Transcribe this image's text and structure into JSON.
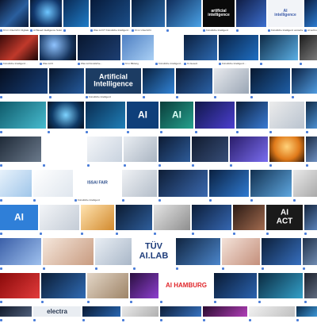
{
  "rows": [
    {
      "tiles": [
        {
          "bg": "linear-gradient(135deg,#0b1630,#2a5f9e 55,#0a1a3a)",
          "caption": "KI im Unterricht: Digitale..."
        },
        {
          "bg": "radial-gradient(circle at 55% 45%,#6ec6ff,#12386d 60%,#051224)",
          "caption": "AI Based Intelligence Solutions..."
        },
        {
          "bg": "linear-gradient(135deg,#0a2a55,#1f7dc9)",
          "caption": ""
        },
        {
          "bg": "linear-gradient(135deg,#071a3a,#1b4f8a)",
          "caption": "Was ist KI? Künstliche Intelligenz..."
        },
        {
          "bg": "linear-gradient(135deg,#09203f,#2c6db0)",
          "caption": "KI im Unterricht"
        },
        {
          "bg": "linear-gradient(135deg,#0f2c5a,#4aa3e8)",
          "caption": ""
        },
        {
          "bg": "#0a0a0a",
          "caption": "Künstliche Intelligenz",
          "text": "artificial\nintelligence",
          "color": "#ffffff"
        },
        {
          "bg": "linear-gradient(135deg,#101d45,#3c6fd0)",
          "caption": ""
        },
        {
          "bg": "#f2f4f8",
          "caption": "Künstliche Intelligenz verstehen",
          "text": "AI\nintelligence",
          "color": "#3b5aa8"
        },
        {
          "bg": "linear-gradient(135deg,#0a1d40,#2b7bd1)",
          "caption": "AI technology..."
        },
        {
          "bg": "linear-gradient(135deg,#1a0b3a,#7b2fbf 60,#0d0a24)",
          "caption": ""
        }
      ]
    },
    {
      "tiles": [
        {
          "bg": "linear-gradient(135deg,#3a0a0a,#c0392b 55,#1a0505)",
          "caption": "Künstliche Intelligenz..."
        },
        {
          "bg": "radial-gradient(circle at 40% 40%,#8fc3ff,#17355e 65%,#050d1c)",
          "caption": "Was ist KI"
        },
        {
          "bg": "linear-gradient(135deg,#08162e,#1d3f73)",
          "caption": "Was ist Künstliche..."
        },
        {
          "bg": "linear-gradient(135deg,#4e7fc2,#aad0f5)",
          "caption": "KI in Bildung"
        },
        {
          "bg": "#ffffff",
          "caption": "Künstliche Intelligenz..."
        },
        {
          "bg": "linear-gradient(135deg,#0b1f3d,#2d6ab3)",
          "caption": "KI-Gesetz"
        },
        {
          "bg": "linear-gradient(135deg,#0a2244,#1f6fc4)",
          "caption": "Künstliche Intelligenz..."
        },
        {
          "bg": "linear-gradient(135deg,#0e2a45,#5bb0e6)",
          "caption": ""
        },
        {
          "bg": "linear-gradient(135deg,#1b1b1b,#7a7a7a)",
          "caption": ""
        }
      ]
    },
    {
      "tiles": [
        {
          "bg": "linear-gradient(135deg,#050d1e,#17407a)",
          "caption": ""
        },
        {
          "bg": "linear-gradient(135deg,#07152b,#245a9d)",
          "caption": ""
        },
        {
          "bg": "#1c3c63",
          "caption": "Künstliche Intelligenz",
          "text": "Artificial\nIntelligence",
          "color": "#ffffff"
        },
        {
          "bg": "linear-gradient(135deg,#09203d,#3183d6)",
          "caption": ""
        },
        {
          "bg": "linear-gradient(135deg,#0c1a33,#2a62a8)",
          "caption": ""
        },
        {
          "bg": "linear-gradient(135deg,#e8eaee,#9aa6b5)",
          "caption": ""
        },
        {
          "bg": "linear-gradient(135deg,#08182f,#1e5ea6)",
          "caption": ""
        },
        {
          "bg": "linear-gradient(135deg,#0b2040,#4f9be0)",
          "caption": ""
        }
      ]
    },
    {
      "tiles": [
        {
          "bg": "linear-gradient(135deg,#0f5a6a,#47bcd0)",
          "caption": ""
        },
        {
          "bg": "radial-gradient(circle at 50% 50%,#7dd3ff,#0f3a66 60%,#04101f)",
          "caption": ""
        },
        {
          "bg": "linear-gradient(135deg,#0a2b4f,#1f7fb8)",
          "caption": ""
        },
        {
          "bg": "#0f3f7a",
          "caption": "",
          "text": "AI",
          "color": "#ffffff"
        },
        {
          "bg": "linear-gradient(135deg,#0a3d3a,#25a18e)",
          "caption": "",
          "text": "AI",
          "color": "#d9fff5"
        },
        {
          "bg": "linear-gradient(135deg,#10174a,#4b3fd0)",
          "caption": ""
        },
        {
          "bg": "linear-gradient(135deg,#0b1f3a,#3a7bd5)",
          "caption": ""
        },
        {
          "bg": "linear-gradient(135deg,#ececec,#b9c3cf)",
          "caption": ""
        },
        {
          "bg": "linear-gradient(135deg,#102a45,#4c8fd1)",
          "caption": ""
        }
      ]
    },
    {
      "tiles": [
        {
          "bg": "linear-gradient(135deg,#1f2a38,#6b7a8c)",
          "caption": ""
        },
        {
          "bg": "#ffffff",
          "caption": ""
        },
        {
          "bg": "linear-gradient(135deg,#f4f6f9,#c9d3df)",
          "caption": ""
        },
        {
          "bg": "linear-gradient(135deg,#e9edf2,#aab5c2)",
          "caption": ""
        },
        {
          "bg": "linear-gradient(135deg,#0d1b33,#2d5b99)",
          "caption": ""
        },
        {
          "bg": "linear-gradient(135deg,#111b2e,#374e79)",
          "caption": ""
        },
        {
          "bg": "linear-gradient(135deg,#2a1d6a,#7a6df0)",
          "caption": ""
        },
        {
          "bg": "radial-gradient(circle at 50% 40%,#ffd27a,#e07a1a 55%,#2a1406)",
          "caption": ""
        },
        {
          "bg": "linear-gradient(135deg,#1b2b44,#6d8fc0)",
          "caption": ""
        }
      ]
    },
    {
      "tiles": [
        {
          "bg": "linear-gradient(135deg,#e8f2fb,#9fc6ea)",
          "caption": ""
        },
        {
          "bg": "linear-gradient(135deg,#ffffff,#dfe6ee)",
          "caption": ""
        },
        {
          "bg": "#ffffff",
          "caption": "Künstliche Intelligenz",
          "text": "ISSAI FAIR",
          "color": "#2a4c8a"
        },
        {
          "bg": "linear-gradient(135deg,#f0f2f5,#b3bdc9)",
          "caption": ""
        },
        {
          "bg": "linear-gradient(135deg,#0e1d35,#3a69b0)",
          "caption": ""
        },
        {
          "bg": "linear-gradient(135deg,#0a2040,#2f7ad1)",
          "caption": ""
        },
        {
          "bg": "linear-gradient(135deg,#12304f,#5ea7e0)",
          "caption": ""
        },
        {
          "bg": "linear-gradient(135deg,#eaeaea,#aaaaaa)",
          "caption": ""
        }
      ]
    },
    {
      "tiles": [
        {
          "bg": "#2f7fd8",
          "caption": "",
          "text": "AI",
          "color": "#ffffff"
        },
        {
          "bg": "linear-gradient(135deg,#f3f5f8,#c4ccd6)",
          "caption": ""
        },
        {
          "bg": "linear-gradient(135deg,#ffe3b0,#d28a2e)",
          "caption": ""
        },
        {
          "bg": "linear-gradient(135deg,#0b1a30,#2e5e9c)",
          "caption": ""
        },
        {
          "bg": "linear-gradient(135deg,#e5e5e5,#8e8e8e)",
          "caption": ""
        },
        {
          "bg": "linear-gradient(135deg,#0c1d38,#3567b2)",
          "caption": ""
        },
        {
          "bg": "linear-gradient(135deg,#2a1a14,#a26b4f)",
          "caption": ""
        },
        {
          "bg": "#1a1a1a",
          "caption": "",
          "text": "AI\nACT",
          "color": "#ffffff"
        },
        {
          "bg": "linear-gradient(135deg,#14243c,#5a82b8)",
          "caption": ""
        },
        {
          "bg": "linear-gradient(135deg,#0d2240,#3b82d6)",
          "caption": ""
        }
      ]
    },
    {
      "tiles": [
        {
          "bg": "linear-gradient(135deg,#3b5fa8,#9fc1ee)",
          "caption": ""
        },
        {
          "bg": "linear-gradient(135deg,#f5e7dc,#c89b80)",
          "caption": ""
        },
        {
          "bg": "linear-gradient(135deg,#e9eef4,#a9b7c8)",
          "caption": ""
        },
        {
          "bg": "#ffffff",
          "caption": "",
          "text": "TÜV\nAI.LAB",
          "color": "#1d3c7a"
        },
        {
          "bg": "linear-gradient(135deg,#10243f,#4b86cc)",
          "caption": ""
        },
        {
          "bg": "linear-gradient(135deg,#f4e3da,#c48f7b)",
          "caption": ""
        },
        {
          "bg": "linear-gradient(135deg,#0c1f39,#366fbf)",
          "caption": ""
        },
        {
          "bg": "linear-gradient(135deg,#203048,#6f8bb1)",
          "caption": ""
        }
      ]
    },
    {
      "tiles": [
        {
          "bg": "linear-gradient(135deg,#8a0a0a,#e23b3b)",
          "caption": ""
        },
        {
          "bg": "linear-gradient(135deg,#0b1c34,#2f6bb5)",
          "caption": ""
        },
        {
          "bg": "linear-gradient(135deg,#e3d6c7,#9e8467)",
          "caption": ""
        },
        {
          "bg": "linear-gradient(135deg,#2a0f3f,#8e3fd0)",
          "caption": ""
        },
        {
          "bg": "#ffffff",
          "caption": "",
          "text": "AI HAMBURG",
          "color": "#e0262b"
        },
        {
          "bg": "linear-gradient(135deg,#0a1a33,#2a63b0)",
          "caption": ""
        },
        {
          "bg": "linear-gradient(135deg,#0b2a40,#33a0c9)",
          "caption": ""
        },
        {
          "bg": "linear-gradient(135deg,#1a1f2a,#5f6b80)",
          "caption": ""
        }
      ]
    },
    {
      "tiles": [
        {
          "bg": "linear-gradient(135deg,#121a2a,#4e5e7a)",
          "caption": ""
        },
        {
          "bg": "#e9edf2",
          "caption": "",
          "text": "electra",
          "color": "#2b3a52"
        },
        {
          "bg": "linear-gradient(135deg,#0a1a33,#2866b1)",
          "caption": ""
        },
        {
          "bg": "linear-gradient(135deg,#e9e9e9,#b0b0b0)",
          "caption": ""
        },
        {
          "bg": "linear-gradient(135deg,#0c1d38,#3672c0)",
          "caption": ""
        },
        {
          "bg": "linear-gradient(135deg,#2b0b2f,#b03fb8)",
          "caption": ""
        },
        {
          "bg": "linear-gradient(135deg,#f1f1f1,#c0c0c0)",
          "caption": ""
        },
        {
          "bg": "linear-gradient(135deg,#0a2a48,#3b95d6)",
          "caption": ""
        }
      ]
    }
  ]
}
